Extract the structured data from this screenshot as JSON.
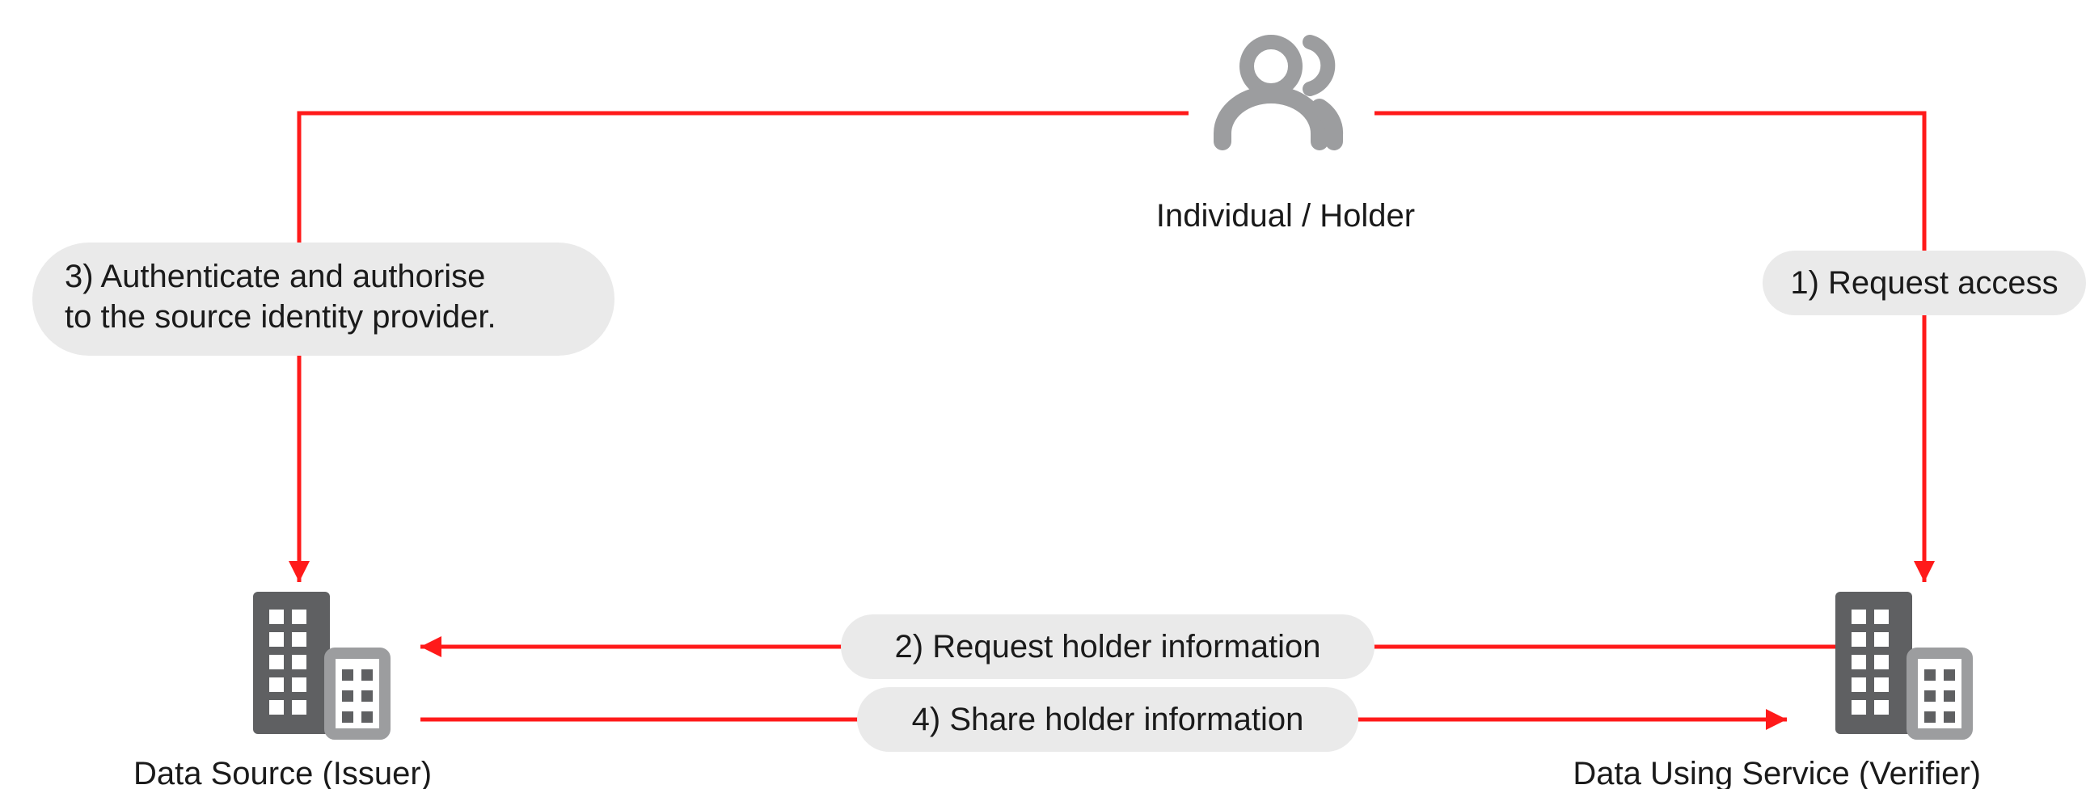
{
  "nodes": {
    "holder": {
      "label": "Individual / Holder"
    },
    "issuer": {
      "label": "Data Source (Issuer)"
    },
    "verifier": {
      "label": "Data Using Service (Verifier)"
    }
  },
  "edges": {
    "request_access": {
      "n": "1",
      "text": "Request access"
    },
    "request_holder_info": {
      "n": "2",
      "text": "Request holder information"
    },
    "authenticate": {
      "n": "3",
      "text": "Authenticate and authorise to the source identity provider."
    },
    "share_holder_info": {
      "n": "4",
      "text": "Share holder information"
    }
  }
}
